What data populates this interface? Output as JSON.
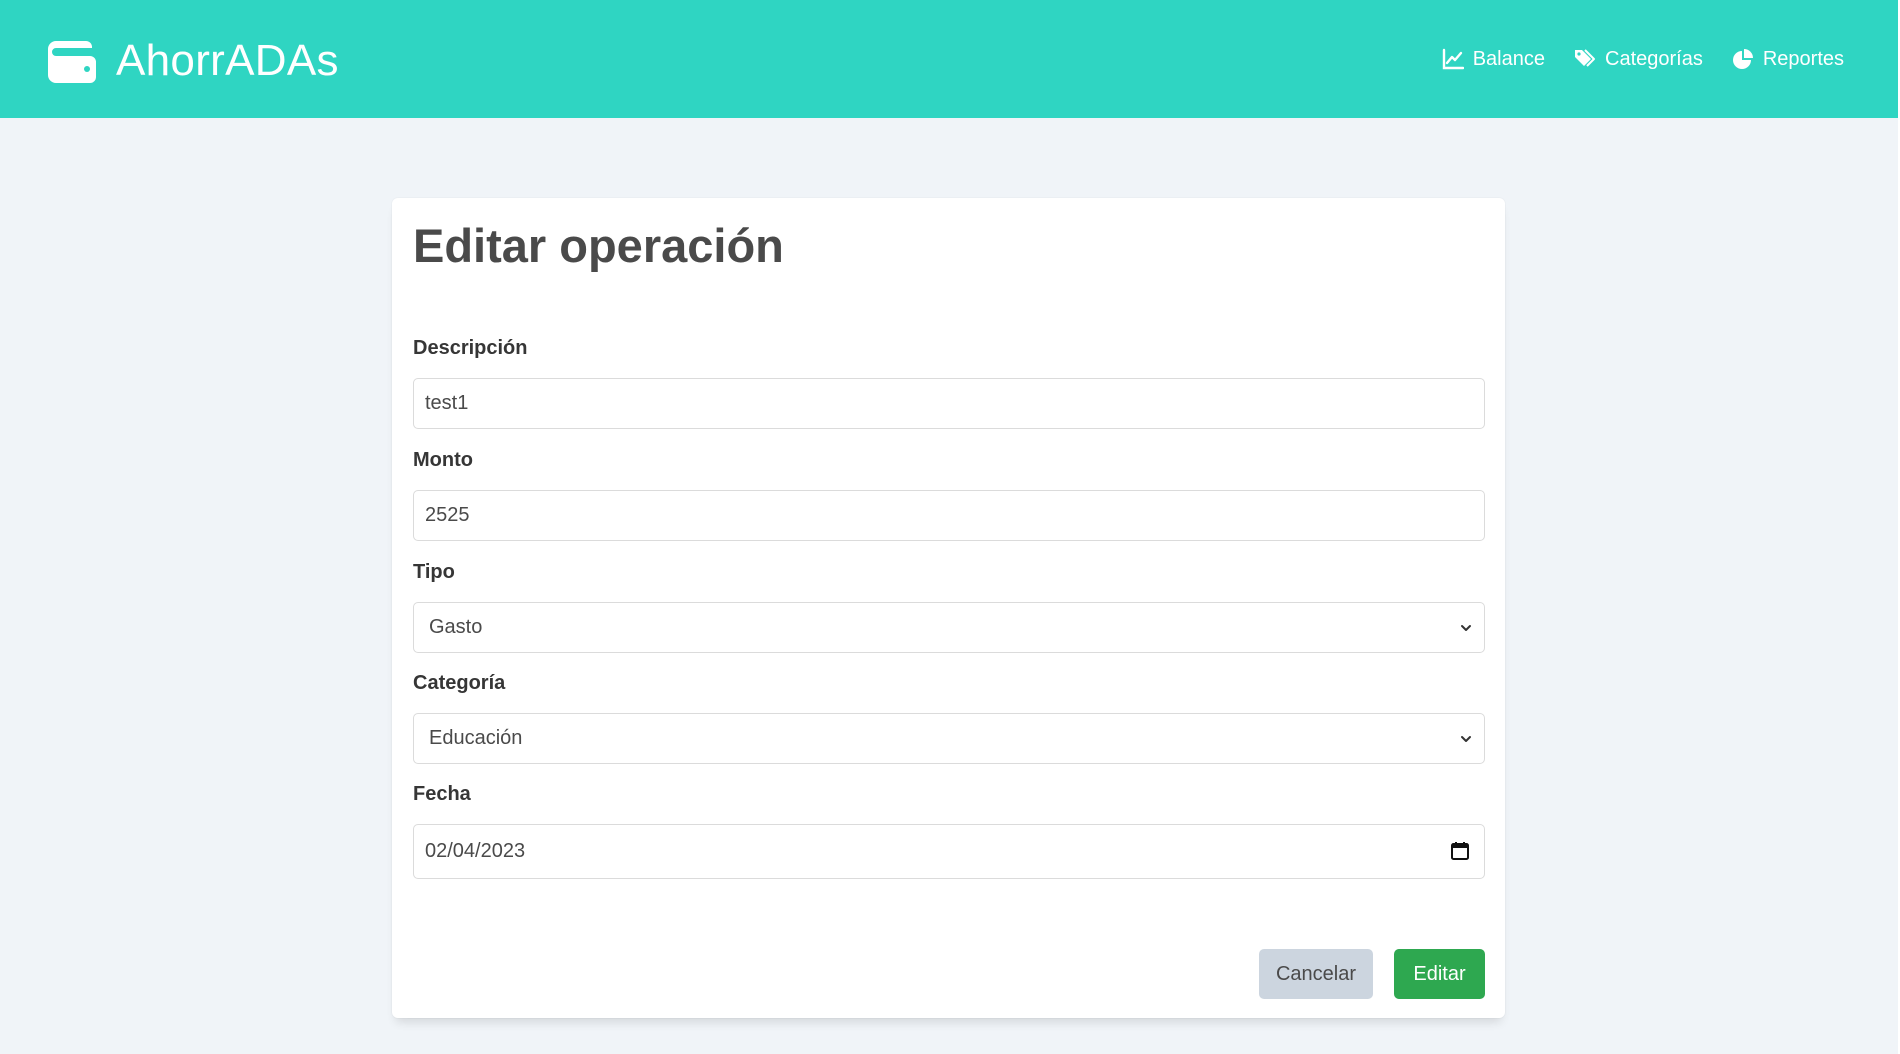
{
  "app": {
    "title": "AhorrADAs",
    "brand_icon": "wallet-icon",
    "colors": {
      "navbar": "#2fd5c2",
      "background": "#f0f4f8",
      "cancel_button": "#ccd5df",
      "edit_button": "#2ea850"
    }
  },
  "nav": {
    "items": [
      {
        "label": "Balance",
        "icon": "chart-line-icon"
      },
      {
        "label": "Categorías",
        "icon": "tags-icon"
      },
      {
        "label": "Reportes",
        "icon": "pie-chart-icon"
      }
    ]
  },
  "form": {
    "title": "Editar operación",
    "descripcion": {
      "label": "Descripción",
      "value": "test1"
    },
    "monto": {
      "label": "Monto",
      "value": "2525"
    },
    "tipo": {
      "label": "Tipo",
      "value": "Gasto"
    },
    "categoria": {
      "label": "Categoría",
      "value": "Educación"
    },
    "fecha": {
      "label": "Fecha",
      "value": "02/04/2023",
      "icon": "calendar-icon"
    },
    "buttons": {
      "cancel": "Cancelar",
      "submit": "Editar"
    }
  }
}
